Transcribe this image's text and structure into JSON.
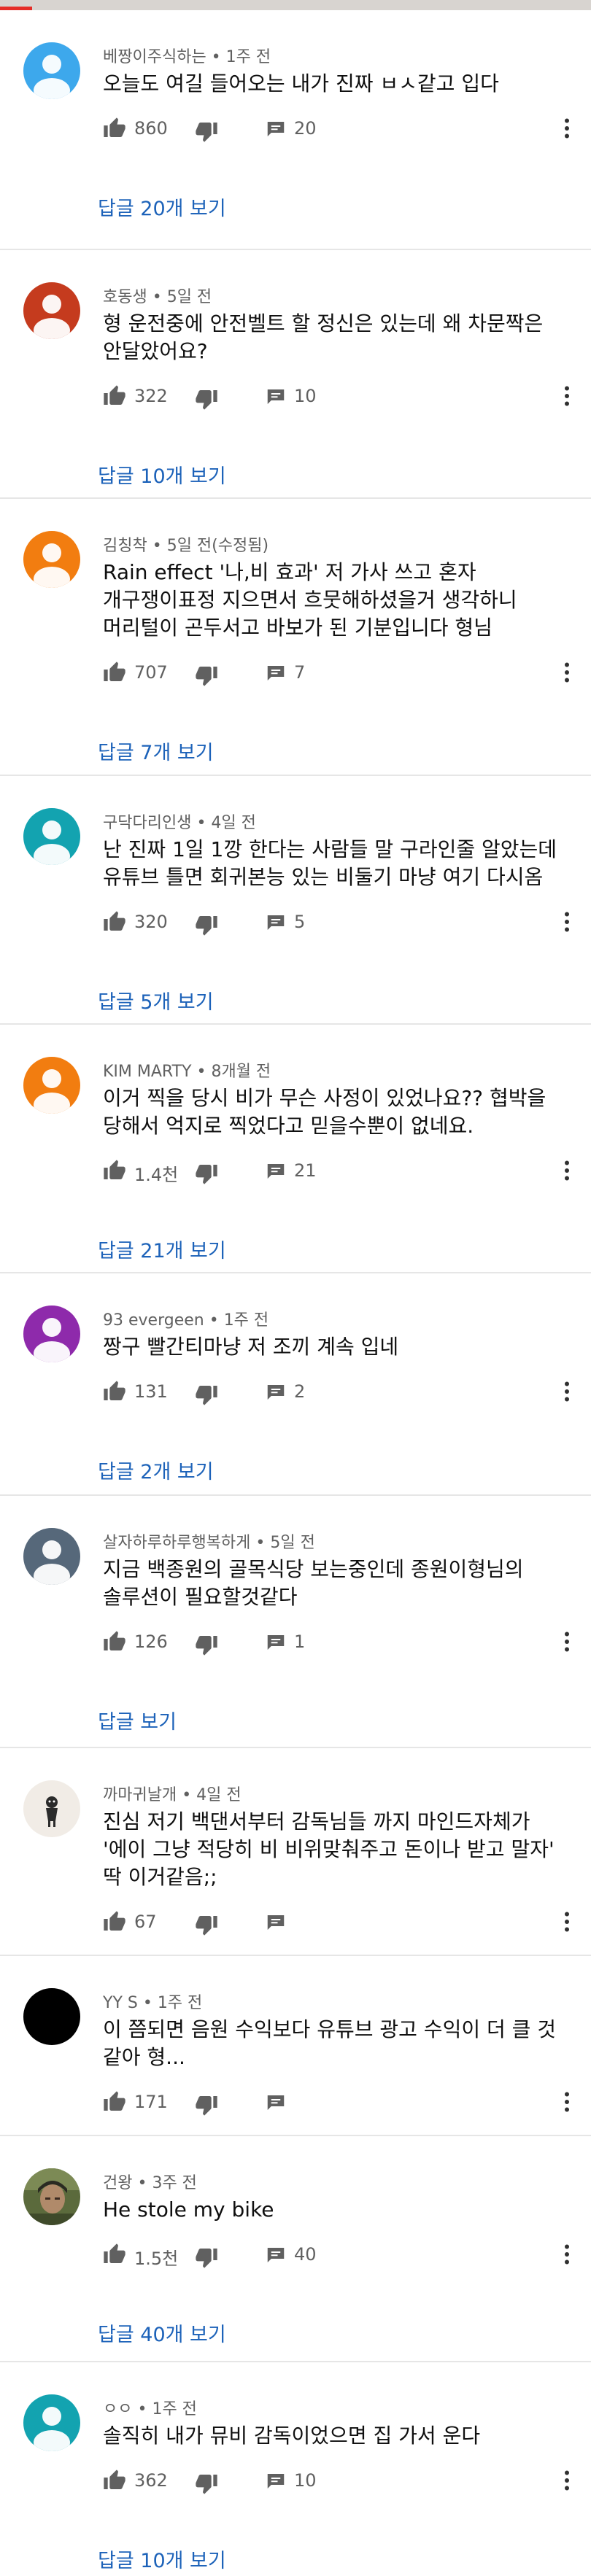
{
  "comments": [
    {
      "author": "베짱이주식하는",
      "time": "1주 전",
      "text": "오늘도 여길 들어오는 내가 진짜 ㅂㅅ같고 입다",
      "likes": "860",
      "replies": "20",
      "view_replies": "답글 20개 보기",
      "avatar": {
        "type": "default",
        "bg": "#3da8ec"
      }
    },
    {
      "author": "호동생",
      "time": "5일 전",
      "text": "형 운전중에 안전벨트 할 정신은 있는데 왜 차문짝은\n안달았어요?",
      "likes": "322",
      "replies": "10",
      "view_replies": "답글 10개 보기",
      "avatar": {
        "type": "default",
        "bg": "#c53b1e"
      }
    },
    {
      "author": "김칭착",
      "time": "5일 전(수정됨)",
      "text": "Rain effect '나,비 효과' 저 가사 쓰고 혼자\n개구쟁이표정 지으면서 흐뭇해하셨을거 생각하니\n머리털이 곤두서고 바보가 된 기분입니다 형님",
      "likes": "707",
      "replies": "7",
      "view_replies": "답글 7개 보기",
      "avatar": {
        "type": "default",
        "bg": "#f27d10"
      }
    },
    {
      "author": "구닥다리인생",
      "time": "4일 전",
      "text": "난 진짜 1일 1깡 한다는 사람들 말 구라인줄 알았는데\n유튜브 틀면 회귀본능 있는 비둘기 마냥 여기 다시옴",
      "likes": "320",
      "replies": "5",
      "view_replies": "답글 5개 보기",
      "avatar": {
        "type": "default",
        "bg": "#13a3b0"
      }
    },
    {
      "author": "KIM MARTY",
      "time": "8개월 전",
      "text": "이거 찍을 당시 비가 무슨 사정이 있었나요?? 협박을\n당해서 억지로 찍었다고 믿을수뿐이 없네요.",
      "likes": "1.4천",
      "replies": "21",
      "view_replies": "답글 21개 보기",
      "avatar": {
        "type": "default",
        "bg": "#f27d10"
      }
    },
    {
      "author": "93 evergeen",
      "time": "1주 전",
      "text": "짱구 빨간티마냥 저 조끼 계속 입네",
      "likes": "131",
      "replies": "2",
      "view_replies": "답글 2개 보기",
      "avatar": {
        "type": "default",
        "bg": "#8e2aab"
      }
    },
    {
      "author": "살자하루하루행복하게",
      "time": "5일 전",
      "text": "지금 백종원의 골목식당 보는중인데  종원이형님의\n솔루션이 필요할것같다",
      "likes": "126",
      "replies": "1",
      "view_replies": "답글 보기",
      "avatar": {
        "type": "default",
        "bg": "#56687a"
      }
    },
    {
      "author": "까마귀날개",
      "time": "4일 전",
      "text": "진심 저기 백댄서부터 감독님들 까지 마인드자체가\n'에이 그냥 적당히 비 비위맞춰주고 돈이나 받고 말자'\n딱 이거같음;;",
      "likes": "67",
      "replies": "",
      "view_replies": "",
      "avatar": {
        "type": "photo-figure",
        "bg": "#f1ece6"
      }
    },
    {
      "author": "YY S",
      "time": "1주 전",
      "text": "이 쯤되면 음원 수익보다 유튜브 광고 수익이 더 클 것\n같아 형...",
      "likes": "171",
      "replies": "",
      "view_replies": "",
      "avatar": {
        "type": "photo-black",
        "bg": "#000000"
      }
    },
    {
      "author": "건왕",
      "time": "3주 전",
      "text": "He stole my bike",
      "likes": "1.5천",
      "replies": "40",
      "view_replies": "답글 40개 보기",
      "avatar": {
        "type": "photo-face",
        "bg": "#5b6a3c"
      }
    },
    {
      "author": "ㅇㅇ",
      "time": "1주 전",
      "text": "솔직히 내가 뮤비 감독이었으면 집 가서 운다",
      "likes": "362",
      "replies": "10",
      "view_replies": "답글 10개 보기",
      "avatar": {
        "type": "default",
        "bg": "#13a3b0"
      }
    }
  ],
  "icons": {
    "like": "thumb-up-icon",
    "dislike": "thumb-down-icon",
    "reply": "reply-icon",
    "more": "more-vert-icon"
  },
  "colors": {
    "link": "#1c62b9",
    "meta": "#606060",
    "divider": "#e6e6e6"
  }
}
